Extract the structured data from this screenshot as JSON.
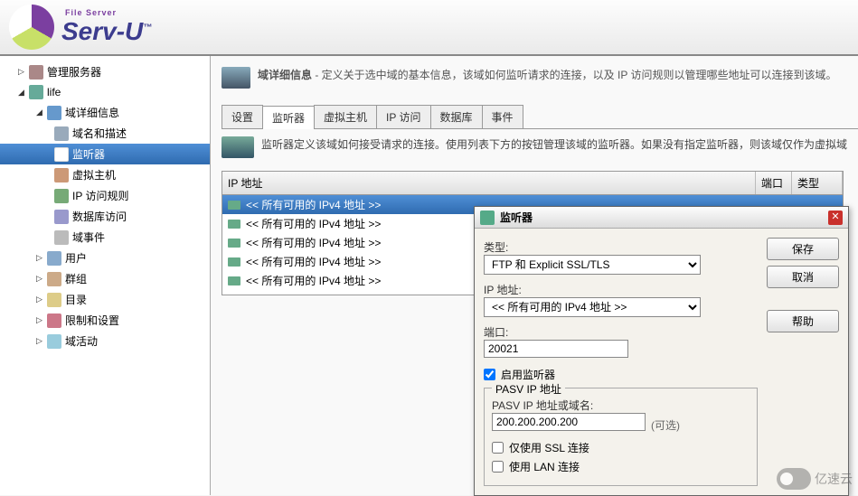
{
  "logo": {
    "sub": "File Server",
    "main": "Serv-U",
    "tm": "™"
  },
  "sidebar": {
    "manage": "管理服务器",
    "domain": "life",
    "detail": "域详细信息",
    "desc": "域名和描述",
    "listener": "监听器",
    "vhost": "虚拟主机",
    "iprule": "IP 访问规则",
    "db": "数据库访问",
    "event": "域事件",
    "user": "用户",
    "group": "群组",
    "dir": "目录",
    "limit": "限制和设置",
    "activity": "域活动"
  },
  "content": {
    "title": "域详细信息",
    "desc": " - 定义关于选中域的基本信息，该域如何监听请求的连接，以及 IP 访问规则以管理哪些地址可以连接到该域。",
    "tabs": {
      "t1": "设置",
      "t2": "监听器",
      "t3": "虚拟主机",
      "t4": "IP 访问",
      "t5": "数据库",
      "t6": "事件"
    },
    "info": "监听器定义该域如何接受请求的连接。使用列表下方的按钮管理该域的监听器。如果没有指定监听器，则该域仅作为虚拟域",
    "grid": {
      "h_ip": "IP 地址",
      "h_port": "端口",
      "h_type": "类型",
      "rowtext": "<< 所有可用的 IPv4 地址 >>",
      "rows": 5
    }
  },
  "dialog": {
    "title": "监听器",
    "btn_save": "保存",
    "btn_cancel": "取消",
    "btn_help": "帮助",
    "lbl_type": "类型:",
    "val_type": "FTP 和  Explicit SSL/TLS",
    "lbl_ip": "IP 地址:",
    "val_ip": "<< 所有可用的  IPv4 地址  >>",
    "lbl_port": "端口:",
    "val_port": "20021",
    "chk_enable": "启用监听器",
    "fs_title": "PASV IP 地址",
    "lbl_pasv": "PASV IP 地址或域名:",
    "val_pasv": "200.200.200.200",
    "opt": "(可选)",
    "chk_ssl": "仅使用 SSL 连接",
    "chk_lan": "使用 LAN 连接"
  },
  "watermark": "亿速云"
}
